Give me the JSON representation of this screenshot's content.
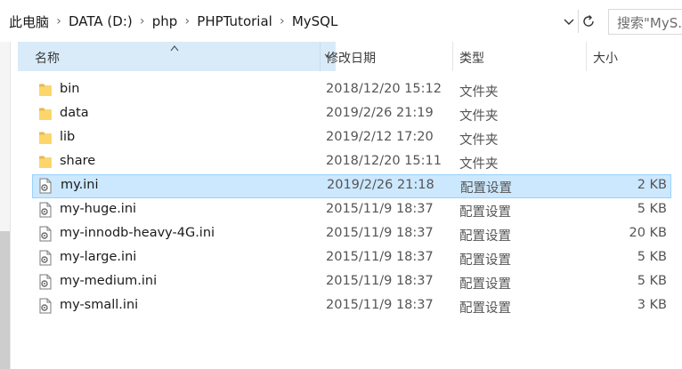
{
  "address_bar": {
    "crumbs": [
      "此电脑",
      "DATA (D:)",
      "php",
      "PHPTutorial",
      "MySQL"
    ],
    "search_placeholder": "搜索\"MyS..."
  },
  "columns": {
    "name": "名称",
    "date_modified": "修改日期",
    "type": "类型",
    "size": "大小"
  },
  "files": [
    {
      "name": "bin",
      "date": "2018/12/20 15:12",
      "type": "文件夹",
      "size": "",
      "icon": "folder-icon"
    },
    {
      "name": "data",
      "date": "2019/2/26 21:19",
      "type": "文件夹",
      "size": "",
      "icon": "folder-icon"
    },
    {
      "name": "lib",
      "date": "2019/2/12 17:20",
      "type": "文件夹",
      "size": "",
      "icon": "folder-icon"
    },
    {
      "name": "share",
      "date": "2018/12/20 15:11",
      "type": "文件夹",
      "size": "",
      "icon": "folder-icon"
    },
    {
      "name": "my.ini",
      "date": "2019/2/26 21:18",
      "type": "配置设置",
      "size": "2 KB",
      "icon": "config-file-icon",
      "selected": true
    },
    {
      "name": "my-huge.ini",
      "date": "2015/11/9 18:37",
      "type": "配置设置",
      "size": "5 KB",
      "icon": "config-file-icon"
    },
    {
      "name": "my-innodb-heavy-4G.ini",
      "date": "2015/11/9 18:37",
      "type": "配置设置",
      "size": "20 KB",
      "icon": "config-file-icon"
    },
    {
      "name": "my-large.ini",
      "date": "2015/11/9 18:37",
      "type": "配置设置",
      "size": "5 KB",
      "icon": "config-file-icon"
    },
    {
      "name": "my-medium.ini",
      "date": "2015/11/9 18:37",
      "type": "配置设置",
      "size": "5 KB",
      "icon": "config-file-icon"
    },
    {
      "name": "my-small.ini",
      "date": "2015/11/9 18:37",
      "type": "配置设置",
      "size": "3 KB",
      "icon": "config-file-icon"
    }
  ],
  "colors": {
    "selection_fill": "#cce8ff",
    "selection_border": "#99d1ff",
    "header_highlight": "#d9ebf9",
    "folder_yellow": "#f8d775"
  }
}
